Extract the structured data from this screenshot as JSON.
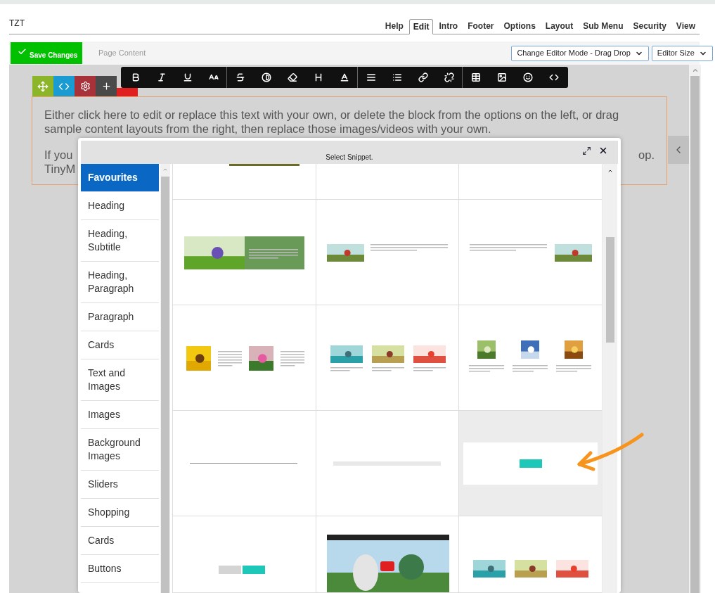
{
  "header": {
    "site": "TZT",
    "tabs": [
      {
        "label": "Help",
        "selected": false
      },
      {
        "label": "Edit",
        "selected": true
      },
      {
        "label": "Intro",
        "selected": false
      },
      {
        "label": "Footer",
        "selected": false
      },
      {
        "label": "Options",
        "selected": false
      },
      {
        "label": "Layout",
        "selected": false
      },
      {
        "label": "Sub Menu",
        "selected": false
      },
      {
        "label": "Security",
        "selected": false
      },
      {
        "label": "View",
        "selected": false
      }
    ]
  },
  "toolbar": {
    "save_button": "Save Changes",
    "section_label": "Page Content",
    "selects": [
      {
        "value": "Change Editor Mode - Drag Drop"
      },
      {
        "value": "Editor Size"
      }
    ]
  },
  "content": {
    "paragraph_1": "Either click here to edit or replace this text with your own, or delete the block from the options on the left, or drag sample content layouts from the right, then replace those images/videos with your own.",
    "paragraph_2_start": "If you",
    "paragraph_2_end": "op.",
    "paragraph_2_line_2": "TinyM"
  },
  "dialog": {
    "title": "Select Snippet.",
    "categories": [
      {
        "label": "Favourites",
        "selected": true
      },
      {
        "label": "Heading",
        "selected": false
      },
      {
        "label": "Heading, Subtitle",
        "selected": false
      },
      {
        "label": "Heading, Paragraph",
        "selected": false
      },
      {
        "label": "Paragraph",
        "selected": false
      },
      {
        "label": "Cards",
        "selected": false
      },
      {
        "label": "Text and Images",
        "selected": false
      },
      {
        "label": "Images",
        "selected": false
      },
      {
        "label": "Background Images",
        "selected": false
      },
      {
        "label": "Sliders",
        "selected": false
      },
      {
        "label": "Shopping",
        "selected": false
      },
      {
        "label": "Cards",
        "selected": false
      },
      {
        "label": "Buttons",
        "selected": false
      }
    ],
    "snippets": [
      {
        "kind": "partial-image",
        "selected": false
      },
      {
        "kind": "blank",
        "selected": false
      },
      {
        "kind": "blank",
        "selected": false
      },
      {
        "kind": "banner",
        "selected": false
      },
      {
        "kind": "image-left",
        "selected": false
      },
      {
        "kind": "image-right",
        "selected": false
      },
      {
        "kind": "two-images",
        "selected": false
      },
      {
        "kind": "three-images",
        "selected": false
      },
      {
        "kind": "three-cards",
        "selected": false
      },
      {
        "kind": "line",
        "selected": false
      },
      {
        "kind": "spacer",
        "selected": false
      },
      {
        "kind": "button",
        "selected": true
      },
      {
        "kind": "two-buttons",
        "selected": false
      },
      {
        "kind": "video",
        "selected": false
      },
      {
        "kind": "three-photos",
        "selected": false
      }
    ]
  }
}
